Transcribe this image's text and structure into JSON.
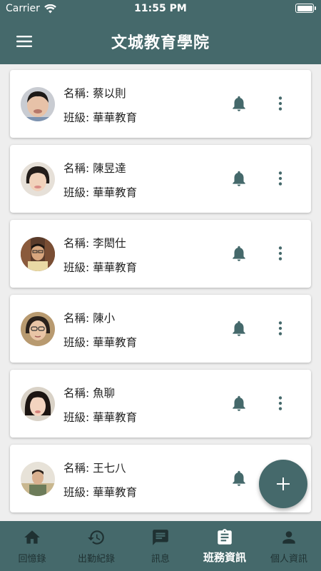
{
  "status_bar": {
    "carrier": "Carrier",
    "time": "11:55 PM"
  },
  "header": {
    "title": "文城教育學院"
  },
  "students": [
    {
      "name": "名稱: 蔡以則",
      "class": "班級: 華華教育"
    },
    {
      "name": "名稱: 陳昱達",
      "class": "班級: 華華教育"
    },
    {
      "name": "名稱: 李閎仕",
      "class": "班級: 華華教育"
    },
    {
      "name": "名稱: 陳小",
      "class": "班級: 華華教育"
    },
    {
      "name": "名稱: 魚聊",
      "class": "班級: 華華教育"
    },
    {
      "name": "名稱: 王七八",
      "class": "班級: 華華教育"
    }
  ],
  "bottom_nav": [
    {
      "label": "回憶錄",
      "icon": "home-icon"
    },
    {
      "label": "出勤紀錄",
      "icon": "history-icon"
    },
    {
      "label": "訊息",
      "icon": "message-icon"
    },
    {
      "label": "班務資訊",
      "icon": "clipboard-icon",
      "active": true
    },
    {
      "label": "個人資訊",
      "icon": "person-icon"
    }
  ],
  "colors": {
    "primary": "#45696b",
    "icon": "#45696b",
    "background": "#eeeeee"
  }
}
